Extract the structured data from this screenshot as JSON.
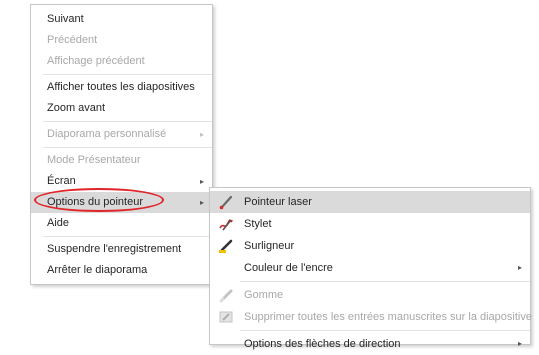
{
  "primary_menu": {
    "items": [
      {
        "label": "Suivant"
      },
      {
        "label": "Précédent"
      },
      {
        "label": "Affichage précédent"
      },
      {
        "label": "Afficher toutes les diapositives"
      },
      {
        "label": "Zoom avant"
      },
      {
        "label": "Diaporama personnalisé"
      },
      {
        "label": "Mode Présentateur"
      },
      {
        "label": "Écran"
      },
      {
        "label": "Options du pointeur"
      },
      {
        "label": "Aide"
      },
      {
        "label": "Suspendre l'enregistrement"
      },
      {
        "label": "Arrêter le diaporama"
      }
    ],
    "submenu_arrow": "▸"
  },
  "pointer_submenu": {
    "items": [
      {
        "label": "Pointeur laser",
        "icon": "laser-pointer-icon"
      },
      {
        "label": "Stylet",
        "icon": "pen-icon"
      },
      {
        "label": "Surligneur",
        "icon": "highlighter-icon"
      },
      {
        "label": "Couleur de l'encre"
      },
      {
        "label": "Gomme",
        "icon": "eraser-icon"
      },
      {
        "label": "Supprimer toutes les entrées manuscrites sur la diapositive",
        "icon": "erase-all-icon"
      },
      {
        "label": "Options des flèches de direction"
      }
    ],
    "submenu_arrow": "▸"
  },
  "colors": {
    "highlight": "#dadada",
    "annotation_circle": "#e0252b",
    "disabled_text": "#a8a8a8"
  }
}
